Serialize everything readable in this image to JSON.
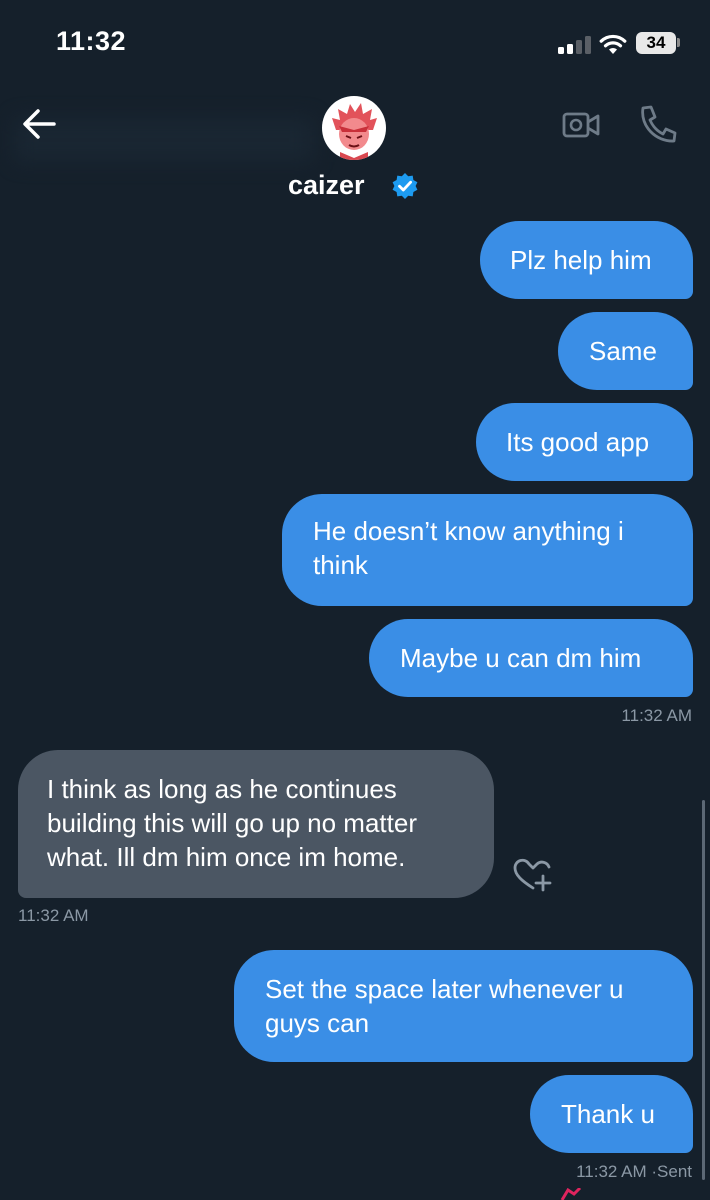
{
  "status_bar": {
    "time": "11:32",
    "battery": "34"
  },
  "header": {
    "contact_name": "caizer"
  },
  "messages": [
    {
      "text": "Plz help him"
    },
    {
      "text": "Same"
    },
    {
      "text": "Its good app"
    },
    {
      "text": "He doesn’t know anything i think"
    },
    {
      "text": "Maybe u can dm him"
    },
    {
      "text": "I think as long as he continues building this will go up no matter what. Ill dm him once im home."
    },
    {
      "text": "Set the space later whenever u guys can"
    },
    {
      "text": "Thank u"
    }
  ],
  "timestamps": [
    "11:32 AM",
    "11:32 AM",
    "11:32 AM ·Sent"
  ],
  "icons": [
    "back-arrow-icon",
    "verified-badge-icon",
    "video-call-icon",
    "phone-icon",
    "heart-plus-icon",
    "signal-icon",
    "wifi-icon",
    "battery-icon"
  ],
  "colors": {
    "background": "#15202b",
    "sent_bubble": "#3a8ee6",
    "received_bubble": "#4b5663",
    "verified_blue": "#1d9bf0",
    "timestamp": "#8b98a5"
  }
}
